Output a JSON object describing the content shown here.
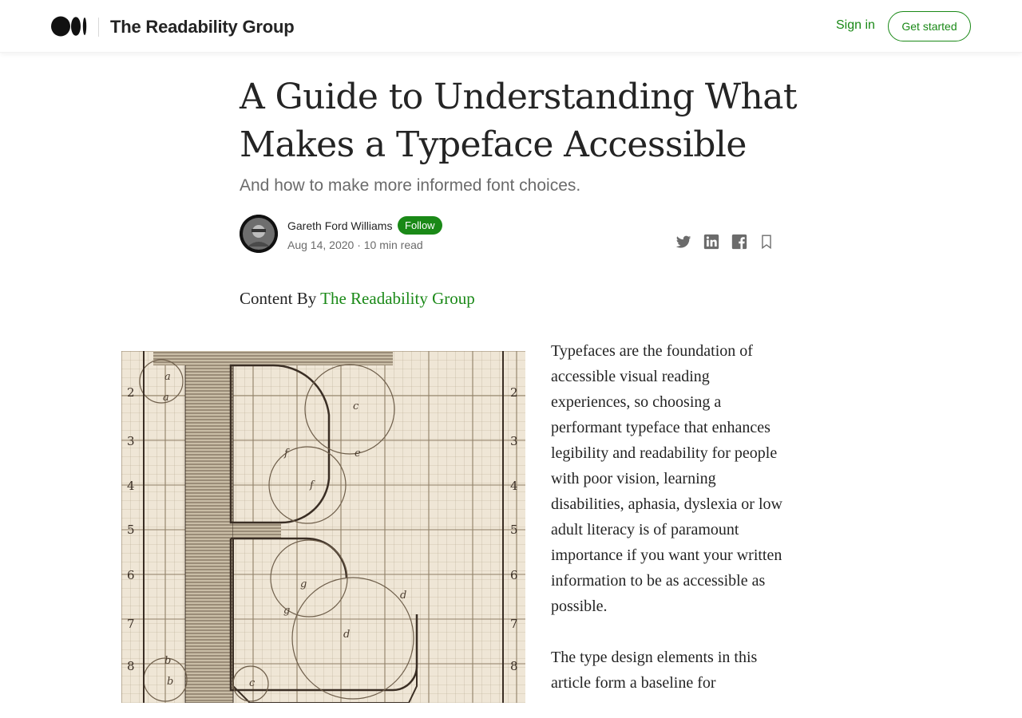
{
  "header": {
    "publication": "The Readability Group",
    "sign_in": "Sign in",
    "get_started": "Get started"
  },
  "article": {
    "title_line1": "A Guide to Understanding What",
    "title_line2": "Makes a Typeface Accessible",
    "subtitle": "And how to make more informed font choices.",
    "author": "Gareth Ford Williams",
    "follow": "Follow",
    "date": "Aug 14, 2020",
    "separator": "·",
    "read_time": "10 min read",
    "content_by_prefix": "Content By",
    "content_by_link": "The Readability Group",
    "paragraphs": [
      "Typefaces are the foundation of accessible visual reading experiences, so choosing a performant typeface that enhances legibility and readability for people with poor vision, learning disabilities, aphasia, dyslexia or low adult literacy is of paramount importance if you want your written information to be as accessible as possible.",
      "The type design elements in this article form a baseline for"
    ]
  },
  "figure": {
    "row_numbers": [
      "2",
      "3",
      "4",
      "5",
      "6",
      "7",
      "8"
    ],
    "letters": [
      "a",
      "a",
      "c",
      "e",
      "f",
      "f",
      "g",
      "g",
      "d",
      "d",
      "b",
      "b",
      "c"
    ]
  },
  "colors": {
    "accent": "#1a8917",
    "text": "#242424",
    "muted": "#6b6b6b",
    "paper": "#efe6d6",
    "ink": "#3a2e24"
  },
  "icons": [
    "medium-logo-icon",
    "twitter-icon",
    "linkedin-icon",
    "facebook-icon",
    "bookmark-icon"
  ]
}
